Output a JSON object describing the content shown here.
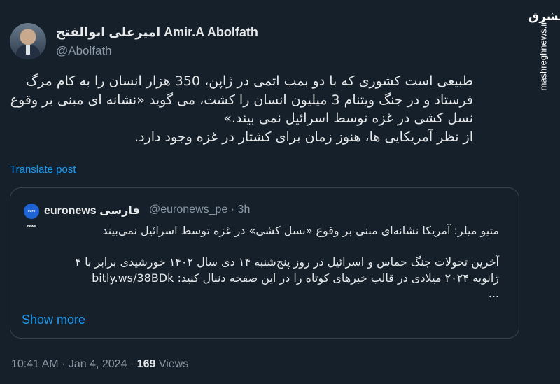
{
  "author": {
    "name_fa": "امیرعلی ابوالفتح",
    "name_en": "Amir.A Abolfath",
    "handle": "@Abolfath"
  },
  "tweet": {
    "lines": [
      "طبیعی است کشوری که با دو بمب اتمی در ژاپن، 350 هزار انسان را به کام مرگ",
      "فرستاد و در جنگ ویتنام 3 میلیون انسان را کشت، می گوید «نشانه ای مبنی بر وقوع",
      "نسل کشی در غزه توسط اسرائیل نمی بیند.»",
      "از نظر آمریکایی ها، هنوز زمان برای کشتار در غزه وجود دارد."
    ],
    "translate_label": "Translate post"
  },
  "quote": {
    "avatar_text": "euro news",
    "name": "euronews فارسی",
    "handle": "@euronews_pe",
    "separator": "·",
    "time": "3h",
    "lines": [
      "متیو میلر: آمریکا نشانه‌ای مبنی بر وقوع «نسل کشی» در غزه توسط اسرائیل نمی‌بیند",
      "",
      "آخرین تحولات جنگ حماس و اسرائیل در روز پنج‌شنبه ۱۴ دی سال ۱۴۰۲ خورشیدی برابر با ۴",
      "ژانویه ۲۰۲۴ میلادی در قالب خبرهای کوتاه را در این صفحه دنبال کنید: bitly.ws/38BDk",
      "..."
    ],
    "show_more_label": "Show more"
  },
  "footer": {
    "time": "10:41 AM",
    "separator1": " · ",
    "date": "Jan 4, 2024",
    "separator2": " · ",
    "views_count": "169",
    "views_label": " Views"
  },
  "watermark": {
    "logo": "مشرق",
    "site": "mashreghnews.ir"
  },
  "icons": {
    "more": "more-icon"
  }
}
